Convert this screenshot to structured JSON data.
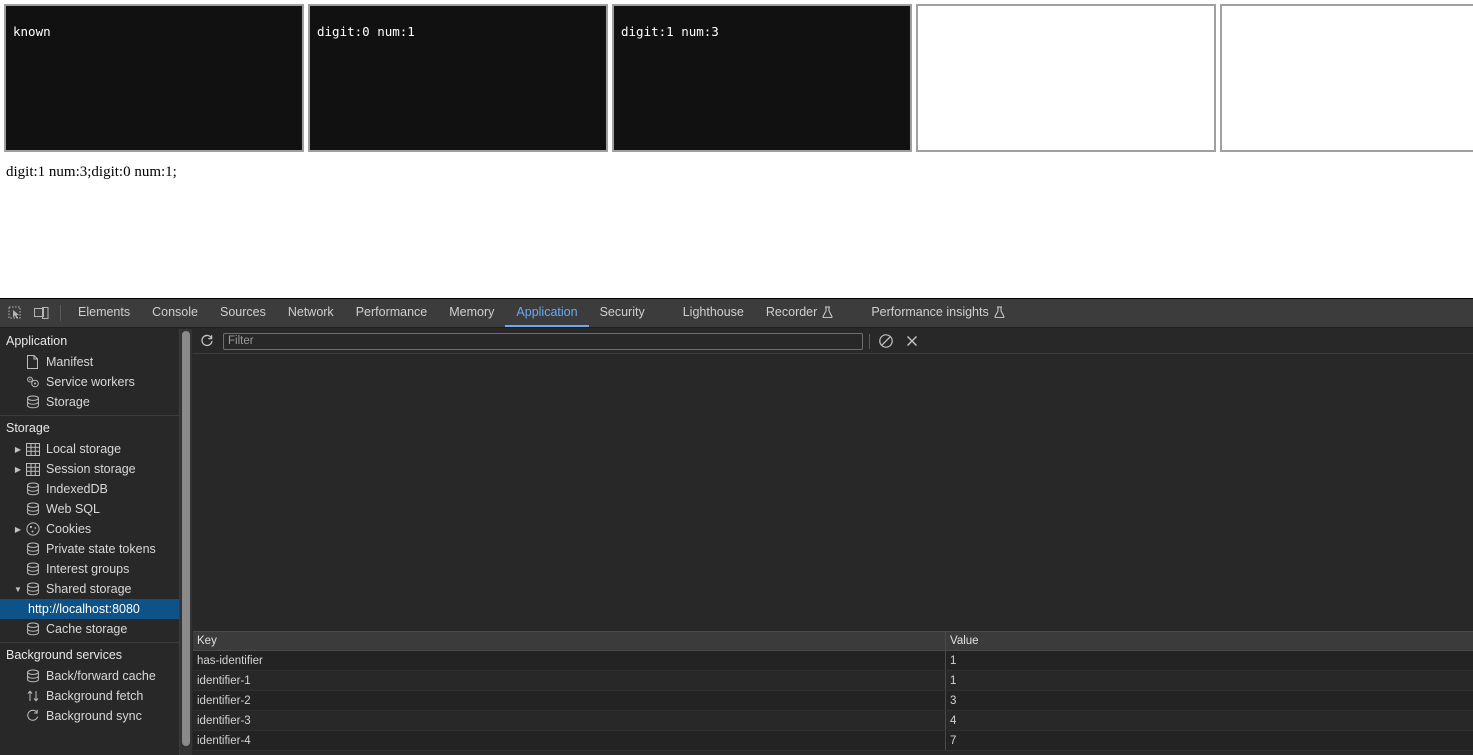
{
  "page": {
    "boxes": [
      {
        "text": "known",
        "empty": false
      },
      {
        "text": "digit:0 num:1",
        "empty": false
      },
      {
        "text": "digit:1 num:3",
        "empty": false
      },
      {
        "text": "",
        "empty": true
      },
      {
        "text": "",
        "empty": true
      }
    ],
    "result_line": "digit:1 num:3;digit:0 num:1;"
  },
  "devtools": {
    "toolbar_icons": [
      {
        "name": "inspect-element-icon"
      },
      {
        "name": "device-toolbar-icon"
      }
    ],
    "tabs": [
      {
        "label": "Elements",
        "active": false,
        "flask": false
      },
      {
        "label": "Console",
        "active": false,
        "flask": false
      },
      {
        "label": "Sources",
        "active": false,
        "flask": false
      },
      {
        "label": "Network",
        "active": false,
        "flask": false
      },
      {
        "label": "Performance",
        "active": false,
        "flask": false
      },
      {
        "label": "Memory",
        "active": false,
        "flask": false
      },
      {
        "label": "Application",
        "active": true,
        "flask": false
      },
      {
        "label": "Security",
        "active": false,
        "flask": false
      },
      {
        "label": "Lighthouse",
        "active": false,
        "flask": false
      },
      {
        "label": "Recorder",
        "active": false,
        "flask": true
      },
      {
        "label": "Performance insights",
        "active": false,
        "flask": true
      }
    ],
    "accent_color": "#6aa9f4",
    "selection_color": "#0d5288",
    "sidebar": {
      "sections": [
        {
          "title": "Application",
          "items": [
            {
              "label": "Manifest",
              "icon": "document-icon",
              "twisty": "none",
              "indent": 1,
              "selected": false
            },
            {
              "label": "Service workers",
              "icon": "gears-icon",
              "twisty": "none",
              "indent": 1,
              "selected": false
            },
            {
              "label": "Storage",
              "icon": "database-icon",
              "twisty": "none",
              "indent": 1,
              "selected": false
            }
          ]
        },
        {
          "title": "Storage",
          "items": [
            {
              "label": "Local storage",
              "icon": "table-icon",
              "twisty": "right",
              "indent": 1,
              "selected": false
            },
            {
              "label": "Session storage",
              "icon": "table-icon",
              "twisty": "right",
              "indent": 1,
              "selected": false
            },
            {
              "label": "IndexedDB",
              "icon": "database-icon",
              "twisty": "none",
              "indent": 1,
              "selected": false
            },
            {
              "label": "Web SQL",
              "icon": "database-icon",
              "twisty": "none",
              "indent": 1,
              "selected": false
            },
            {
              "label": "Cookies",
              "icon": "cookie-icon",
              "twisty": "right",
              "indent": 1,
              "selected": false
            },
            {
              "label": "Private state tokens",
              "icon": "database-icon",
              "twisty": "none",
              "indent": 1,
              "selected": false
            },
            {
              "label": "Interest groups",
              "icon": "database-icon",
              "twisty": "none",
              "indent": 1,
              "selected": false
            },
            {
              "label": "Shared storage",
              "icon": "database-icon",
              "twisty": "down",
              "indent": 1,
              "selected": false
            },
            {
              "label": "http://localhost:8080",
              "icon": "none",
              "twisty": "none",
              "indent": 2,
              "selected": true
            },
            {
              "label": "Cache storage",
              "icon": "database-icon",
              "twisty": "none",
              "indent": 1,
              "selected": false
            }
          ]
        },
        {
          "title": "Background services",
          "items": [
            {
              "label": "Back/forward cache",
              "icon": "database-icon",
              "twisty": "none",
              "indent": 1,
              "selected": false
            },
            {
              "label": "Background fetch",
              "icon": "arrows-updown-icon",
              "twisty": "none",
              "indent": 1,
              "selected": false
            },
            {
              "label": "Background sync",
              "icon": "sync-icon",
              "twisty": "none",
              "indent": 1,
              "selected": false
            }
          ]
        }
      ]
    },
    "filterbar": {
      "refresh_icon": "refresh-icon",
      "filter_value": "",
      "filter_placeholder": "Filter",
      "clear_icon": "block-clear-icon",
      "delete_icon": "close-x-icon"
    },
    "datagrid": {
      "columns": [
        "Key",
        "Value"
      ],
      "rows": [
        {
          "key": "has-identifier",
          "value": "1"
        },
        {
          "key": "identifier-1",
          "value": "1"
        },
        {
          "key": "identifier-2",
          "value": "3"
        },
        {
          "key": "identifier-3",
          "value": "4"
        },
        {
          "key": "identifier-4",
          "value": "7"
        }
      ]
    }
  }
}
